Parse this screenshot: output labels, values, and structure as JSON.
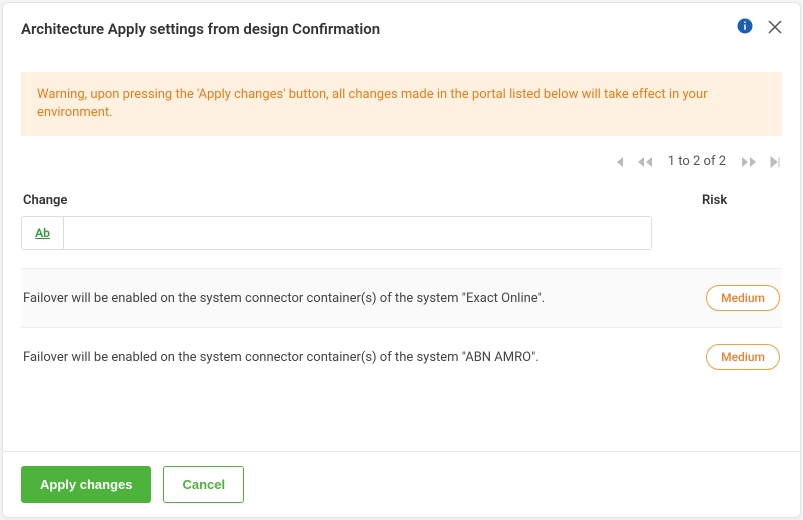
{
  "header": {
    "title": "Architecture Apply settings from design Confirmation"
  },
  "warning": "Warning, upon pressing the 'Apply changes' button, all changes made in the portal listed below will take effect in your environment.",
  "pager": {
    "text": "1 to 2 of 2"
  },
  "columns": {
    "change": "Change",
    "risk": "Risk"
  },
  "filter": {
    "ab_label": "Ab",
    "value": ""
  },
  "rows": [
    {
      "change": "Failover will be enabled on the system connector container(s) of the system \"Exact Online\".",
      "risk": "Medium"
    },
    {
      "change": "Failover will be enabled on the system connector container(s) of the system \"ABN AMRO\".",
      "risk": "Medium"
    }
  ],
  "footer": {
    "apply": "Apply changes",
    "cancel": "Cancel"
  }
}
